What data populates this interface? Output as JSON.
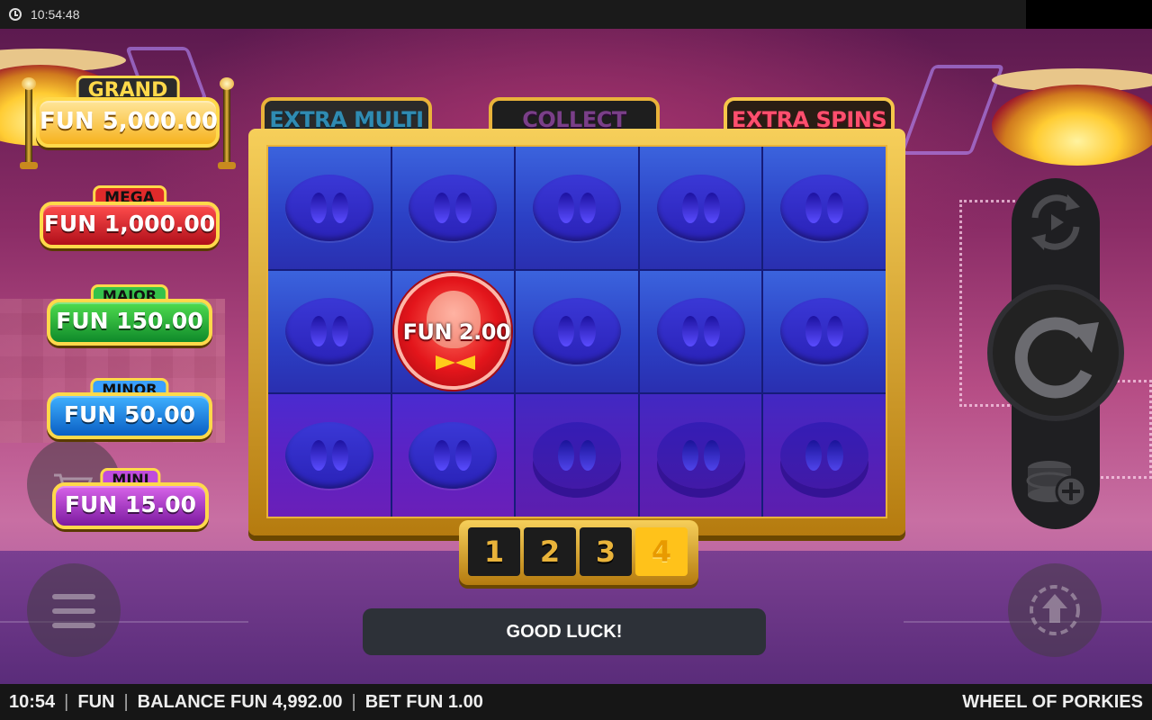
{
  "system": {
    "clock": "10:54:48"
  },
  "jackpots": {
    "grand": {
      "label": "GRAND",
      "value": "FUN 5,000.00"
    },
    "mega": {
      "label": "MEGA",
      "value": "FUN 1,000.00"
    },
    "major": {
      "label": "MAJOR",
      "value": "FUN 150.00"
    },
    "minor": {
      "label": "MINOR",
      "value": "FUN 50.00"
    },
    "mini": {
      "label": "MINI",
      "value": "FUN 15.00"
    }
  },
  "features": {
    "extra_multi": "EXTRA MULTI",
    "collect": "COLLECT",
    "extra_spins": "EXTRA SPINS"
  },
  "grid": {
    "rows": 3,
    "cols": 5,
    "coin": {
      "row": 2,
      "col": 2,
      "value": "FUN 2.00",
      "icon": "pig-coin-icon"
    }
  },
  "spins_remaining": {
    "options": [
      "1",
      "2",
      "3",
      "4"
    ],
    "active": "4"
  },
  "message": "GOOD LUCK!",
  "controls": {
    "autoplay_icon": "autoplay-icon",
    "spin_icon": "spin-icon",
    "bet_icon": "coin-stack-icon",
    "turbo_icon": "turbo-icon",
    "cart_icon": "shopping-cart-icon",
    "menu_icon": "hamburger-menu-icon"
  },
  "status": {
    "time": "10:54",
    "mode": "FUN",
    "balance": "BALANCE FUN 4,992.00",
    "bet": "BET FUN 1.00",
    "game_title": "WHEEL OF PORKIES"
  },
  "colors": {
    "gold": "#e9b33a",
    "grand": "#f6b21e",
    "mega": "#e02a2a",
    "major": "#35c24a",
    "minor": "#3aa0ff",
    "mini": "#c04bdc",
    "reel_blue": "#2b3fc4"
  }
}
